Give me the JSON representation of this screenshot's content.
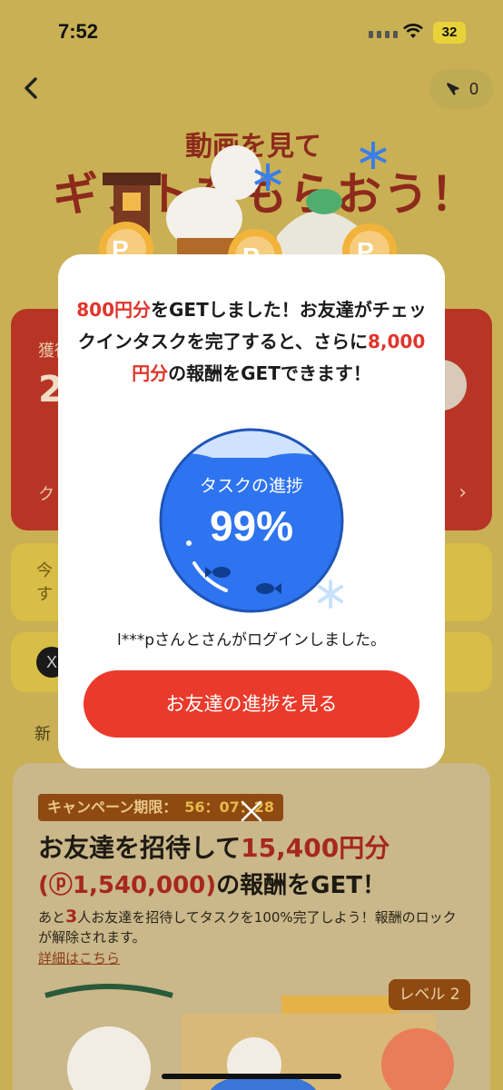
{
  "status_bar": {
    "time": "7:52",
    "battery": "32"
  },
  "top_bar": {
    "ticket_count": "0"
  },
  "background": {
    "hero_title_line1": "動画を見て",
    "hero_title_line2": "ギフトをもらおう！",
    "card_label": "獲得",
    "card_value": "2",
    "card_footer": "ク",
    "notice_text": "今 ま\nす",
    "section_title": "新"
  },
  "campaign": {
    "badge_label": "キャンペーン期限：",
    "timer": "56：07：28",
    "headline_prefix": "お友達を招待して",
    "headline_amount": "15,400円分",
    "headline2_points": "(ⓟ1,540,000)",
    "headline2_suffix": "の報酬をGET！",
    "desc_prefix": "あと",
    "desc_count": "3",
    "desc_suffix": "人お友達を招待してタスクを100%完了しよう！報酬のロックが解除されます。",
    "details_link": "詳細はこちら",
    "level_badge": "レベル 2"
  },
  "modal": {
    "msg_amount": "800円分",
    "msg_part1": "をGETしました！お友達がチェックインタスクを完了すると、さらに",
    "msg_amount2": "8,000円分",
    "msg_part2": "の報酬をGETできます！",
    "progress_label": "タスクの進捗",
    "progress_value": "99%",
    "progress_fraction": 0.99,
    "login_note": "l***pさんとさんがログインしました。",
    "cta_label": "お友達の進捗を見る"
  },
  "colors": {
    "accent_red": "#ea3a2b",
    "highlight_red": "#e0352b",
    "orb_blue": "#2e74f0",
    "dim_background": "#c9b054"
  },
  "icons": [
    "back-chevron-icon",
    "ticket-icon",
    "wifi-icon",
    "close-icon",
    "x-logo-icon",
    "chevron-right-icon"
  ]
}
